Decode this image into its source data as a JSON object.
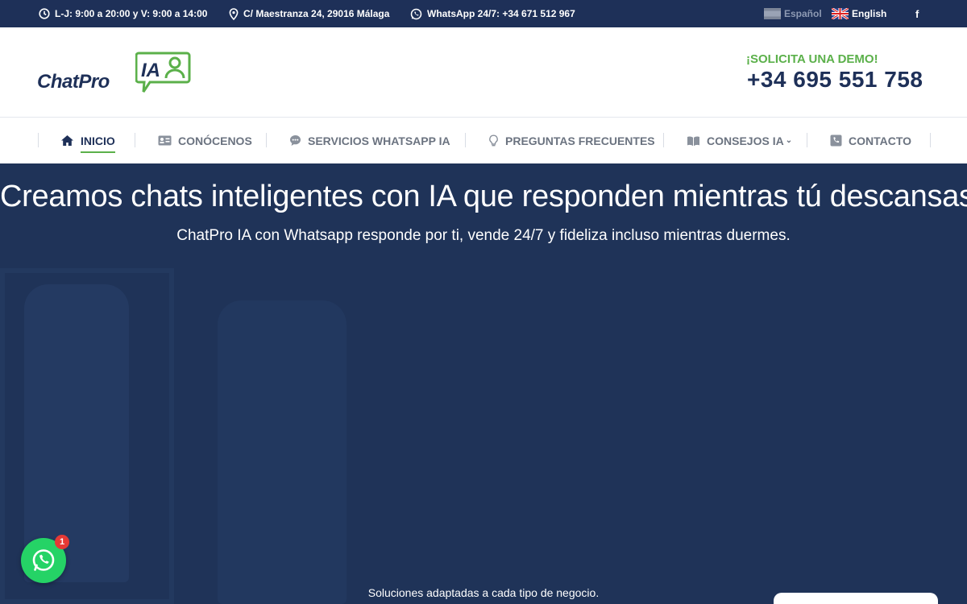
{
  "topbar": {
    "hours": "L-J: 9:00 a 20:00 y V: 9:00 a 14:00",
    "address": "C/ Maestranza 24, 29016 Málaga",
    "whatsapp": "WhatsApp 24/7: +34 671 512 967",
    "lang_es": "Español",
    "lang_en": "English",
    "facebook": "f"
  },
  "header": {
    "logo_text": "ChatPro",
    "logo_ia": "IA",
    "demo_label": "¡SOLICITA UNA DEMO!",
    "phone": "+34 695 551 758"
  },
  "nav": {
    "items": [
      {
        "label": "INICIO",
        "icon": "home-icon",
        "active": true
      },
      {
        "label": "CONÓCENOS",
        "icon": "id-card-icon"
      },
      {
        "label": "SERVICIOS WHATSAPP IA",
        "icon": "chat-bubble-icon"
      },
      {
        "label": "PREGUNTAS FRECUENTES",
        "icon": "lightbulb-icon"
      },
      {
        "label": "CONSEJOS IA",
        "icon": "book-icon",
        "has_dropdown": true
      },
      {
        "label": "CONTACTO",
        "icon": "phone-icon"
      }
    ]
  },
  "hero": {
    "title": "Creamos chats inteligentes con IA que responden mientras tú descansas",
    "subtitle": "ChatPro IA con Whatsapp responde por ti, vende 24/7 y fideliza incluso mientras duermes.",
    "small_text": "Soluciones adaptadas a cada tipo de negocio."
  },
  "whatsapp_float": {
    "badge": "1"
  },
  "colors": {
    "navy": "#1e3058",
    "green": "#5bb04a",
    "whatsapp": "#25d366"
  }
}
